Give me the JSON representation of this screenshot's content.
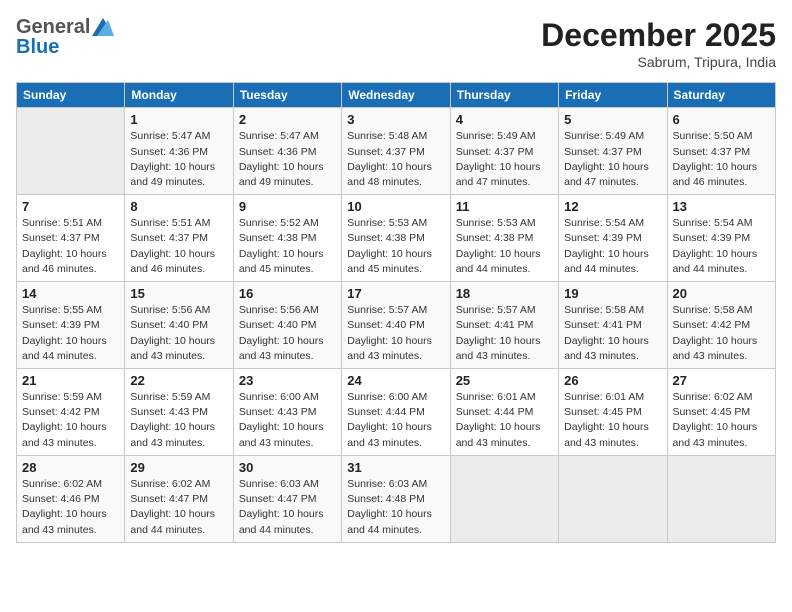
{
  "header": {
    "logo_general": "General",
    "logo_blue": "Blue",
    "month_title": "December 2025",
    "subtitle": "Sabrum, Tripura, India"
  },
  "weekdays": [
    "Sunday",
    "Monday",
    "Tuesday",
    "Wednesday",
    "Thursday",
    "Friday",
    "Saturday"
  ],
  "weeks": [
    [
      {
        "day": "",
        "info": ""
      },
      {
        "day": "1",
        "info": "Sunrise: 5:47 AM\nSunset: 4:36 PM\nDaylight: 10 hours\nand 49 minutes."
      },
      {
        "day": "2",
        "info": "Sunrise: 5:47 AM\nSunset: 4:36 PM\nDaylight: 10 hours\nand 49 minutes."
      },
      {
        "day": "3",
        "info": "Sunrise: 5:48 AM\nSunset: 4:37 PM\nDaylight: 10 hours\nand 48 minutes."
      },
      {
        "day": "4",
        "info": "Sunrise: 5:49 AM\nSunset: 4:37 PM\nDaylight: 10 hours\nand 47 minutes."
      },
      {
        "day": "5",
        "info": "Sunrise: 5:49 AM\nSunset: 4:37 PM\nDaylight: 10 hours\nand 47 minutes."
      },
      {
        "day": "6",
        "info": "Sunrise: 5:50 AM\nSunset: 4:37 PM\nDaylight: 10 hours\nand 46 minutes."
      }
    ],
    [
      {
        "day": "7",
        "info": "Sunrise: 5:51 AM\nSunset: 4:37 PM\nDaylight: 10 hours\nand 46 minutes."
      },
      {
        "day": "8",
        "info": "Sunrise: 5:51 AM\nSunset: 4:37 PM\nDaylight: 10 hours\nand 46 minutes."
      },
      {
        "day": "9",
        "info": "Sunrise: 5:52 AM\nSunset: 4:38 PM\nDaylight: 10 hours\nand 45 minutes."
      },
      {
        "day": "10",
        "info": "Sunrise: 5:53 AM\nSunset: 4:38 PM\nDaylight: 10 hours\nand 45 minutes."
      },
      {
        "day": "11",
        "info": "Sunrise: 5:53 AM\nSunset: 4:38 PM\nDaylight: 10 hours\nand 44 minutes."
      },
      {
        "day": "12",
        "info": "Sunrise: 5:54 AM\nSunset: 4:39 PM\nDaylight: 10 hours\nand 44 minutes."
      },
      {
        "day": "13",
        "info": "Sunrise: 5:54 AM\nSunset: 4:39 PM\nDaylight: 10 hours\nand 44 minutes."
      }
    ],
    [
      {
        "day": "14",
        "info": "Sunrise: 5:55 AM\nSunset: 4:39 PM\nDaylight: 10 hours\nand 44 minutes."
      },
      {
        "day": "15",
        "info": "Sunrise: 5:56 AM\nSunset: 4:40 PM\nDaylight: 10 hours\nand 43 minutes."
      },
      {
        "day": "16",
        "info": "Sunrise: 5:56 AM\nSunset: 4:40 PM\nDaylight: 10 hours\nand 43 minutes."
      },
      {
        "day": "17",
        "info": "Sunrise: 5:57 AM\nSunset: 4:40 PM\nDaylight: 10 hours\nand 43 minutes."
      },
      {
        "day": "18",
        "info": "Sunrise: 5:57 AM\nSunset: 4:41 PM\nDaylight: 10 hours\nand 43 minutes."
      },
      {
        "day": "19",
        "info": "Sunrise: 5:58 AM\nSunset: 4:41 PM\nDaylight: 10 hours\nand 43 minutes."
      },
      {
        "day": "20",
        "info": "Sunrise: 5:58 AM\nSunset: 4:42 PM\nDaylight: 10 hours\nand 43 minutes."
      }
    ],
    [
      {
        "day": "21",
        "info": "Sunrise: 5:59 AM\nSunset: 4:42 PM\nDaylight: 10 hours\nand 43 minutes."
      },
      {
        "day": "22",
        "info": "Sunrise: 5:59 AM\nSunset: 4:43 PM\nDaylight: 10 hours\nand 43 minutes."
      },
      {
        "day": "23",
        "info": "Sunrise: 6:00 AM\nSunset: 4:43 PM\nDaylight: 10 hours\nand 43 minutes."
      },
      {
        "day": "24",
        "info": "Sunrise: 6:00 AM\nSunset: 4:44 PM\nDaylight: 10 hours\nand 43 minutes."
      },
      {
        "day": "25",
        "info": "Sunrise: 6:01 AM\nSunset: 4:44 PM\nDaylight: 10 hours\nand 43 minutes."
      },
      {
        "day": "26",
        "info": "Sunrise: 6:01 AM\nSunset: 4:45 PM\nDaylight: 10 hours\nand 43 minutes."
      },
      {
        "day": "27",
        "info": "Sunrise: 6:02 AM\nSunset: 4:45 PM\nDaylight: 10 hours\nand 43 minutes."
      }
    ],
    [
      {
        "day": "28",
        "info": "Sunrise: 6:02 AM\nSunset: 4:46 PM\nDaylight: 10 hours\nand 43 minutes."
      },
      {
        "day": "29",
        "info": "Sunrise: 6:02 AM\nSunset: 4:47 PM\nDaylight: 10 hours\nand 44 minutes."
      },
      {
        "day": "30",
        "info": "Sunrise: 6:03 AM\nSunset: 4:47 PM\nDaylight: 10 hours\nand 44 minutes."
      },
      {
        "day": "31",
        "info": "Sunrise: 6:03 AM\nSunset: 4:48 PM\nDaylight: 10 hours\nand 44 minutes."
      },
      {
        "day": "",
        "info": ""
      },
      {
        "day": "",
        "info": ""
      },
      {
        "day": "",
        "info": ""
      }
    ]
  ]
}
